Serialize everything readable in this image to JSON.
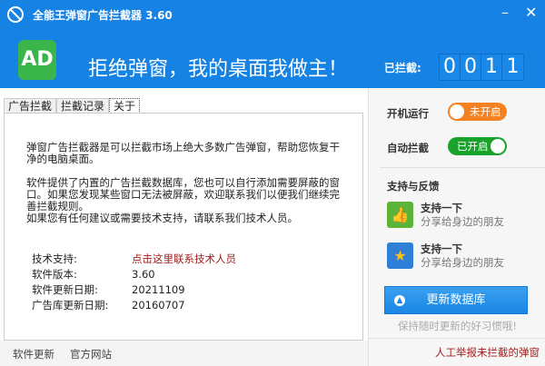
{
  "window": {
    "title": "全能王弹窗广告拦截器  3.60",
    "minimize": "–",
    "close": "✕"
  },
  "header": {
    "logo": "AD",
    "slogan": "拒绝弹窗，我的桌面我做主！",
    "blocked_label": "已拦截:",
    "counter": [
      "0",
      "0",
      "1",
      "1"
    ]
  },
  "tabs": [
    {
      "label": "广告拦截"
    },
    {
      "label": "拦截记录"
    },
    {
      "label": "关于"
    }
  ],
  "about": {
    "para1": "弹窗广告拦截器是可以拦截市场上绝大多数广告弹窗，帮助您恢复干净的电脑桌面。",
    "para2": "软件提供了内置的广告拦截数据库，您也可以自行添加需要屏蔽的窗口。如果您发现某些窗口无法被屏蔽，欢迎联系我们以便我们继续完善拦截规则。",
    "para3": "如果您有任何建议或需要技术支持，请联系我们技术人员。",
    "rows": [
      {
        "key": "技术支持:",
        "value": "点击这里联系技术人员"
      },
      {
        "key": "软件版本:",
        "value": "3.60"
      },
      {
        "key": "软件更新日期:",
        "value": "20211109"
      },
      {
        "key": "广告库更新日期:",
        "value": "20160707"
      }
    ]
  },
  "footer": {
    "software_update": "软件更新",
    "official_site": "官方网站"
  },
  "right": {
    "startup_label": "开机运行",
    "startup_state": "未开启",
    "auto_label": "自动拦截",
    "auto_state": "已开启",
    "support_title": "支持与反馈",
    "share": [
      {
        "title": "支持一下",
        "sub": "分享给身边的朋友"
      },
      {
        "title": "支持一下",
        "sub": "分享给身边的朋友"
      }
    ],
    "update_button": "更新数据库",
    "hint": "保持随时更新的好习惯哦!",
    "report": "人工举报未拦截的弹窗"
  },
  "colors": {
    "header": "#1582e4",
    "off": "#f58220",
    "on": "#1aa32a",
    "link": "#a02020"
  }
}
